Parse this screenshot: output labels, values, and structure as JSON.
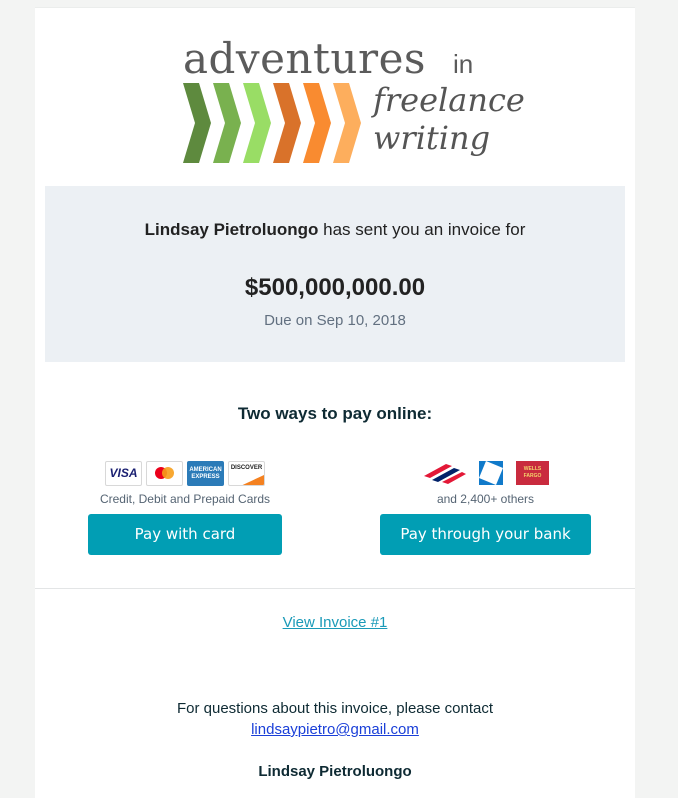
{
  "brand": {
    "logo_line1": "adventures",
    "logo_in": "in",
    "logo_line2": "freelance",
    "logo_line3": "writing",
    "chevron_colors": [
      "#5e8a3e",
      "#79b14f",
      "#99dd65",
      "#d9722a",
      "#f98b30",
      "#fdae5d"
    ]
  },
  "summary": {
    "sender_name": "Lindsay Pietroluongo",
    "sent_text": " has sent you an invoice for",
    "amount": "$500,000,000.00",
    "due": "Due on Sep 10, 2018"
  },
  "payment": {
    "heading": "Two ways to pay online:",
    "card": {
      "logos": [
        "VISA",
        "mastercard",
        "AMERICAN EXPRESS",
        "DISCOVER"
      ],
      "caption": "Credit, Debit and Prepaid Cards",
      "button_label": "Pay with card"
    },
    "bank": {
      "logos": [
        "bank-of-america",
        "chase",
        "WELLS FARGO"
      ],
      "caption": "and 2,400+ others",
      "button_label": "Pay through your bank"
    }
  },
  "links": {
    "view_invoice": "View Invoice #1"
  },
  "contact": {
    "text": "For questions about this invoice, please contact",
    "email": "lindsaypietro@gmail.com",
    "signature": "Lindsay Pietroluongo"
  },
  "colors": {
    "accent": "#019eb4",
    "summary_bg": "#ecf0f4",
    "page_bg": "#f3f4f3"
  }
}
